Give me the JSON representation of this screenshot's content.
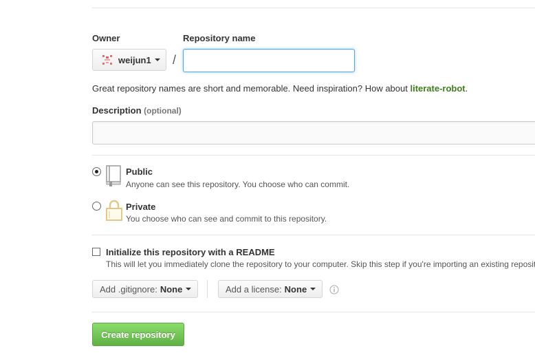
{
  "owner": {
    "label": "Owner",
    "value": "weijun1",
    "avatar_icon": "identicon-icon"
  },
  "repo_name": {
    "label": "Repository name",
    "value": "",
    "placeholder": ""
  },
  "separator": "/",
  "hint": {
    "text": "Great repository names are short and memorable. Need inspiration? How about ",
    "suggestion": "literate-robot",
    "suffix": "."
  },
  "description": {
    "label": "Description",
    "optional": "(optional)",
    "value": ""
  },
  "visibility": {
    "selected": "public",
    "options": [
      {
        "id": "public",
        "title": "Public",
        "desc": "Anyone can see this repository. You choose who can commit.",
        "icon": "book-icon"
      },
      {
        "id": "private",
        "title": "Private",
        "desc": "You choose who can see and commit to this repository.",
        "icon": "lock-icon"
      }
    ]
  },
  "readme": {
    "checked": false,
    "title": "Initialize this repository with a README",
    "desc": "This will let you immediately clone the repository to your computer. Skip this step if you're importing an existing reposit"
  },
  "gitignore": {
    "label": "Add .gitignore:",
    "value": "None"
  },
  "license": {
    "label": "Add a license:",
    "value": "None",
    "info_icon": "info-icon"
  },
  "create_button": "Create repository",
  "colors": {
    "link_green": "#3d7e1a",
    "button_green_top": "#8add6d",
    "button_green_bottom": "#60b044",
    "focus_blue": "#51a7e8",
    "lock_yellow": "#e0c98a"
  }
}
